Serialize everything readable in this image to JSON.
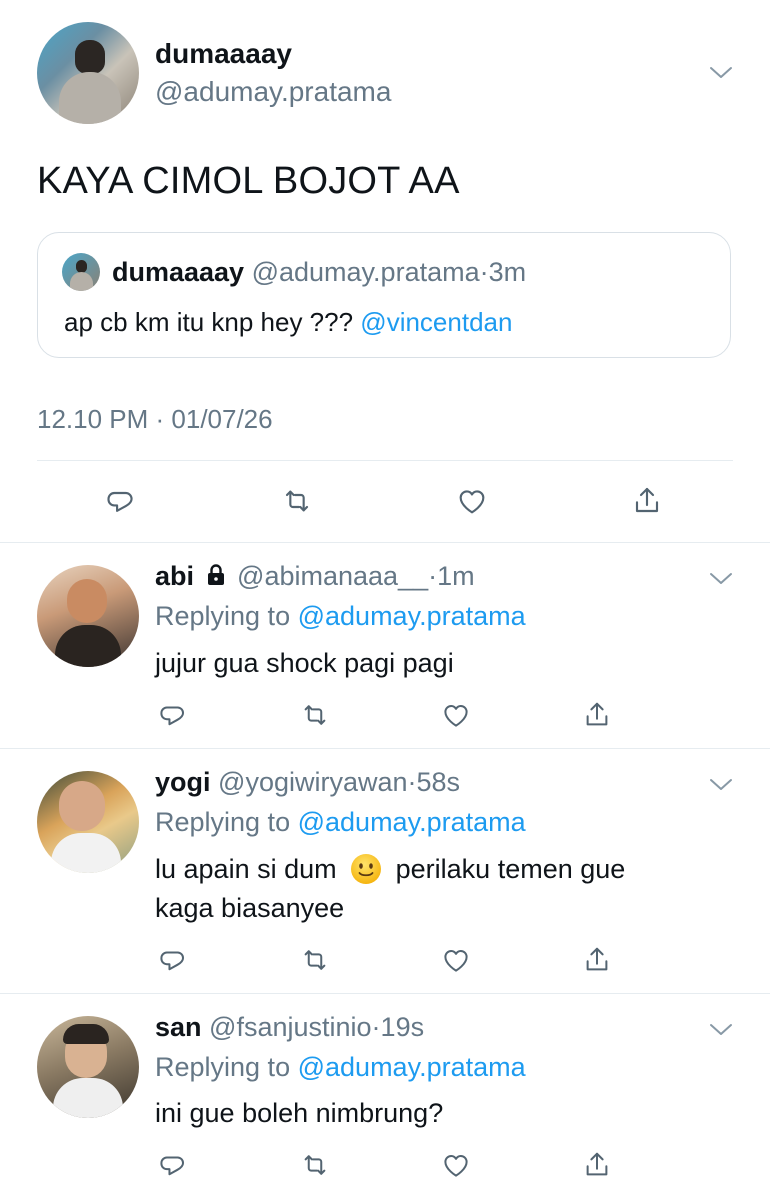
{
  "main_tweet": {
    "display_name": "dumaaaay",
    "handle": "@adumay.pratama",
    "text": "KAYA CIMOL BOJOT AA",
    "quote": {
      "display_name": "dumaaaay",
      "handle": "@adumay.pratama",
      "sep": "·",
      "time": "3m",
      "text": "ap cb km itu knp hey ???",
      "mention": "@vincentdan"
    },
    "timestamp": "12.10 PM · 01/07/26",
    "actions": [
      "reply-icon",
      "retweet-icon",
      "like-icon",
      "share-icon"
    ]
  },
  "replies": [
    {
      "display_name": "abi",
      "locked": true,
      "handle": "@abimanaaa__",
      "sep": "·",
      "time": "1m",
      "replying_label": "Replying to",
      "replying_to": "@adumay.pratama",
      "text": "jujur gua shock pagi pagi"
    },
    {
      "display_name": "yogi",
      "handle": "@yogiwiryawan",
      "sep": "·",
      "time": "58s",
      "replying_label": "Replying to",
      "replying_to": "@adumay.pratama",
      "text_line1_pre": "lu apain si dum",
      "emoji": "🙂",
      "text_line1_post": "perilaku temen gue",
      "text_line2": "kaga biasanyee"
    },
    {
      "display_name": "san",
      "handle": "@fsanjustinio",
      "sep": "·",
      "time": "19s",
      "replying_label": "Replying to",
      "replying_to": "@adumay.pratama",
      "text": "ini gue boleh nimbrung?"
    }
  ],
  "colors": {
    "link": "#1d9bf0",
    "muted": "#657786",
    "divider": "#e6ecf0",
    "text": "#0f1419"
  }
}
